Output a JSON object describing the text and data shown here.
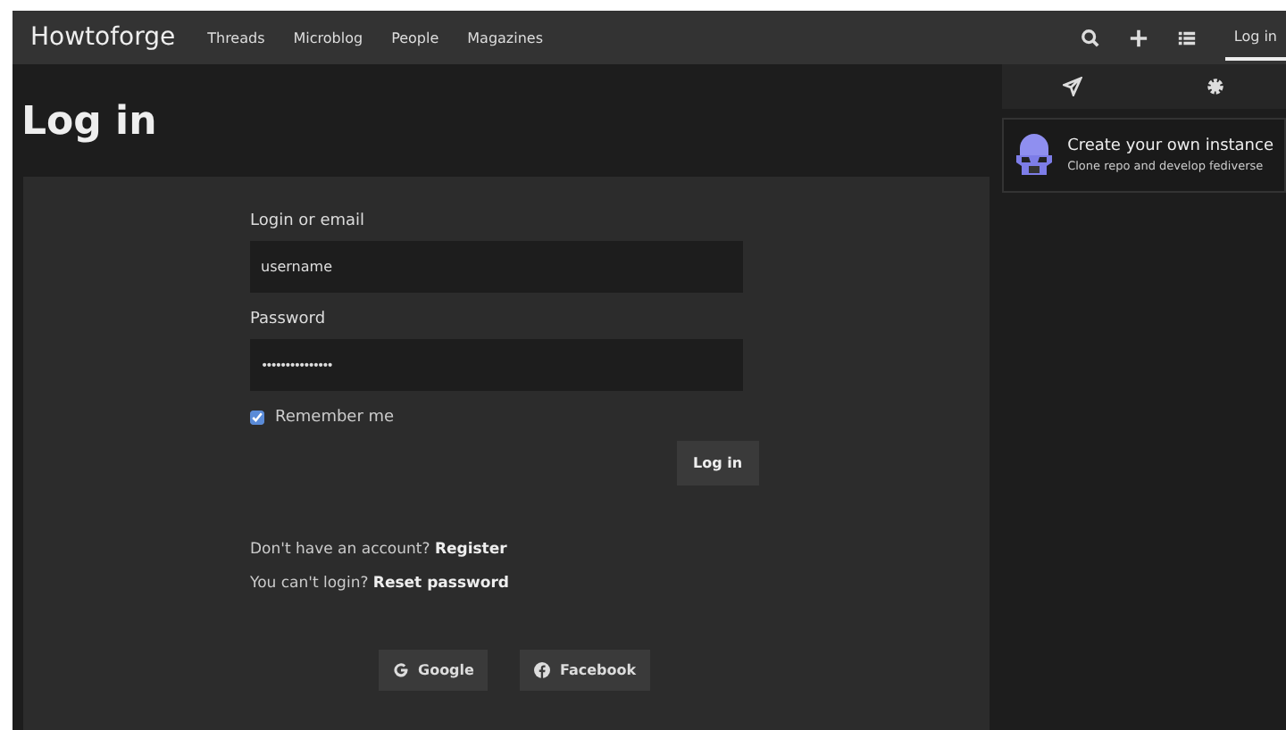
{
  "navbar": {
    "brand": "Howtoforge",
    "links": [
      {
        "label": "Threads"
      },
      {
        "label": "Microblog"
      },
      {
        "label": "People"
      },
      {
        "label": "Magazines"
      }
    ],
    "login": {
      "label": "Log in",
      "selected": true
    }
  },
  "page": {
    "title": "Log in"
  },
  "form": {
    "fields": [
      {
        "label": "Login or email",
        "kind": "text",
        "value": "username"
      },
      {
        "label": "Password",
        "kind": "password",
        "value": "•••••••••••••••"
      }
    ],
    "remember": {
      "label": "Remember me",
      "checked": true
    },
    "submit": "Log in",
    "links": [
      {
        "text": "Don't have an account?",
        "link": "Register"
      },
      {
        "text": "You can't login?",
        "link": "Reset password"
      }
    ],
    "providers": [
      {
        "kind": "google",
        "label": "Google"
      },
      {
        "kind": "facebook",
        "label": "Facebook"
      }
    ]
  },
  "sidebar": {
    "card": {
      "title": "Create your own instance",
      "subtitle": "Clone repo and develop fediverse"
    }
  }
}
